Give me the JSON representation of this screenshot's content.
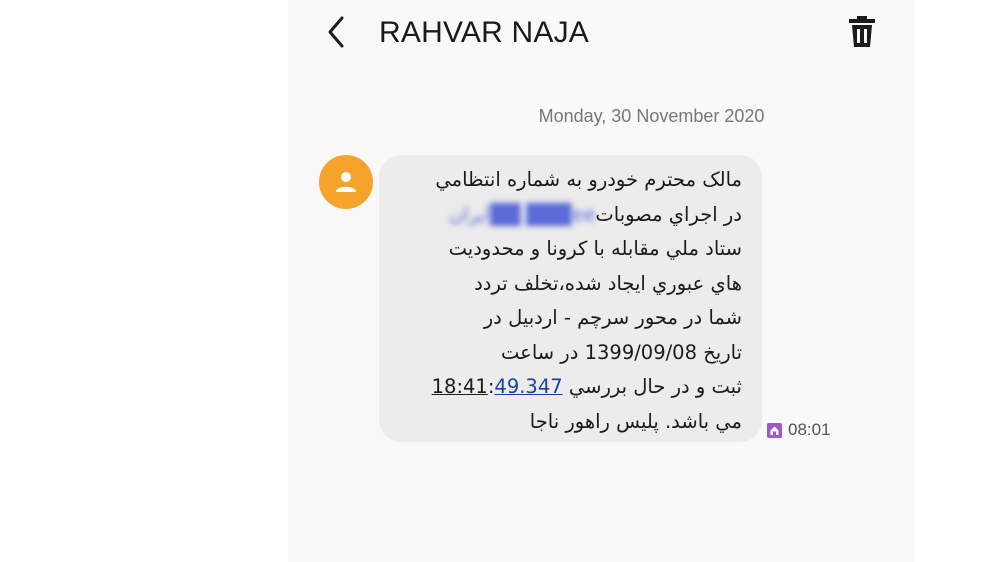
{
  "header": {
    "title": "RAHVAR NAJA",
    "back_icon": "chevron-left-icon",
    "delete_icon": "trash-icon"
  },
  "conversation": {
    "date": "Monday, 30 November 2020",
    "message": {
      "line1": "مالک محترم خودرو به شماره انتظامي",
      "line2_prefix": "ايران",
      "line2_redacted": "███ ██",
      "line2_mid": "ee",
      "line2_suffix": "در اجراي مصوبات",
      "line3": "ستاد ملي مقابله با کرونا و محدوديت",
      "line4": "هاي عبوري ايجاد شده،تخلف تردد",
      "line5": "شما در محور سرچم - اردبيل در",
      "line6": "تاريخ 1399/09/08 در ساعت",
      "line7_time": "18:41",
      "line7_colon": ":",
      "line7_coord": "49.347",
      "line7_suffix": "ثبت و در حال بررسي",
      "line8": "مي باشد. پليس راهور ناجا"
    },
    "timestamp": "08:01",
    "avatar_icon": "person-icon",
    "sim_icon": "sim-home-icon"
  },
  "colors": {
    "avatar": "#f6a32c",
    "bubble": "#ececec",
    "link": "#1f3fa8",
    "sim_badge": "#9b59c9"
  }
}
